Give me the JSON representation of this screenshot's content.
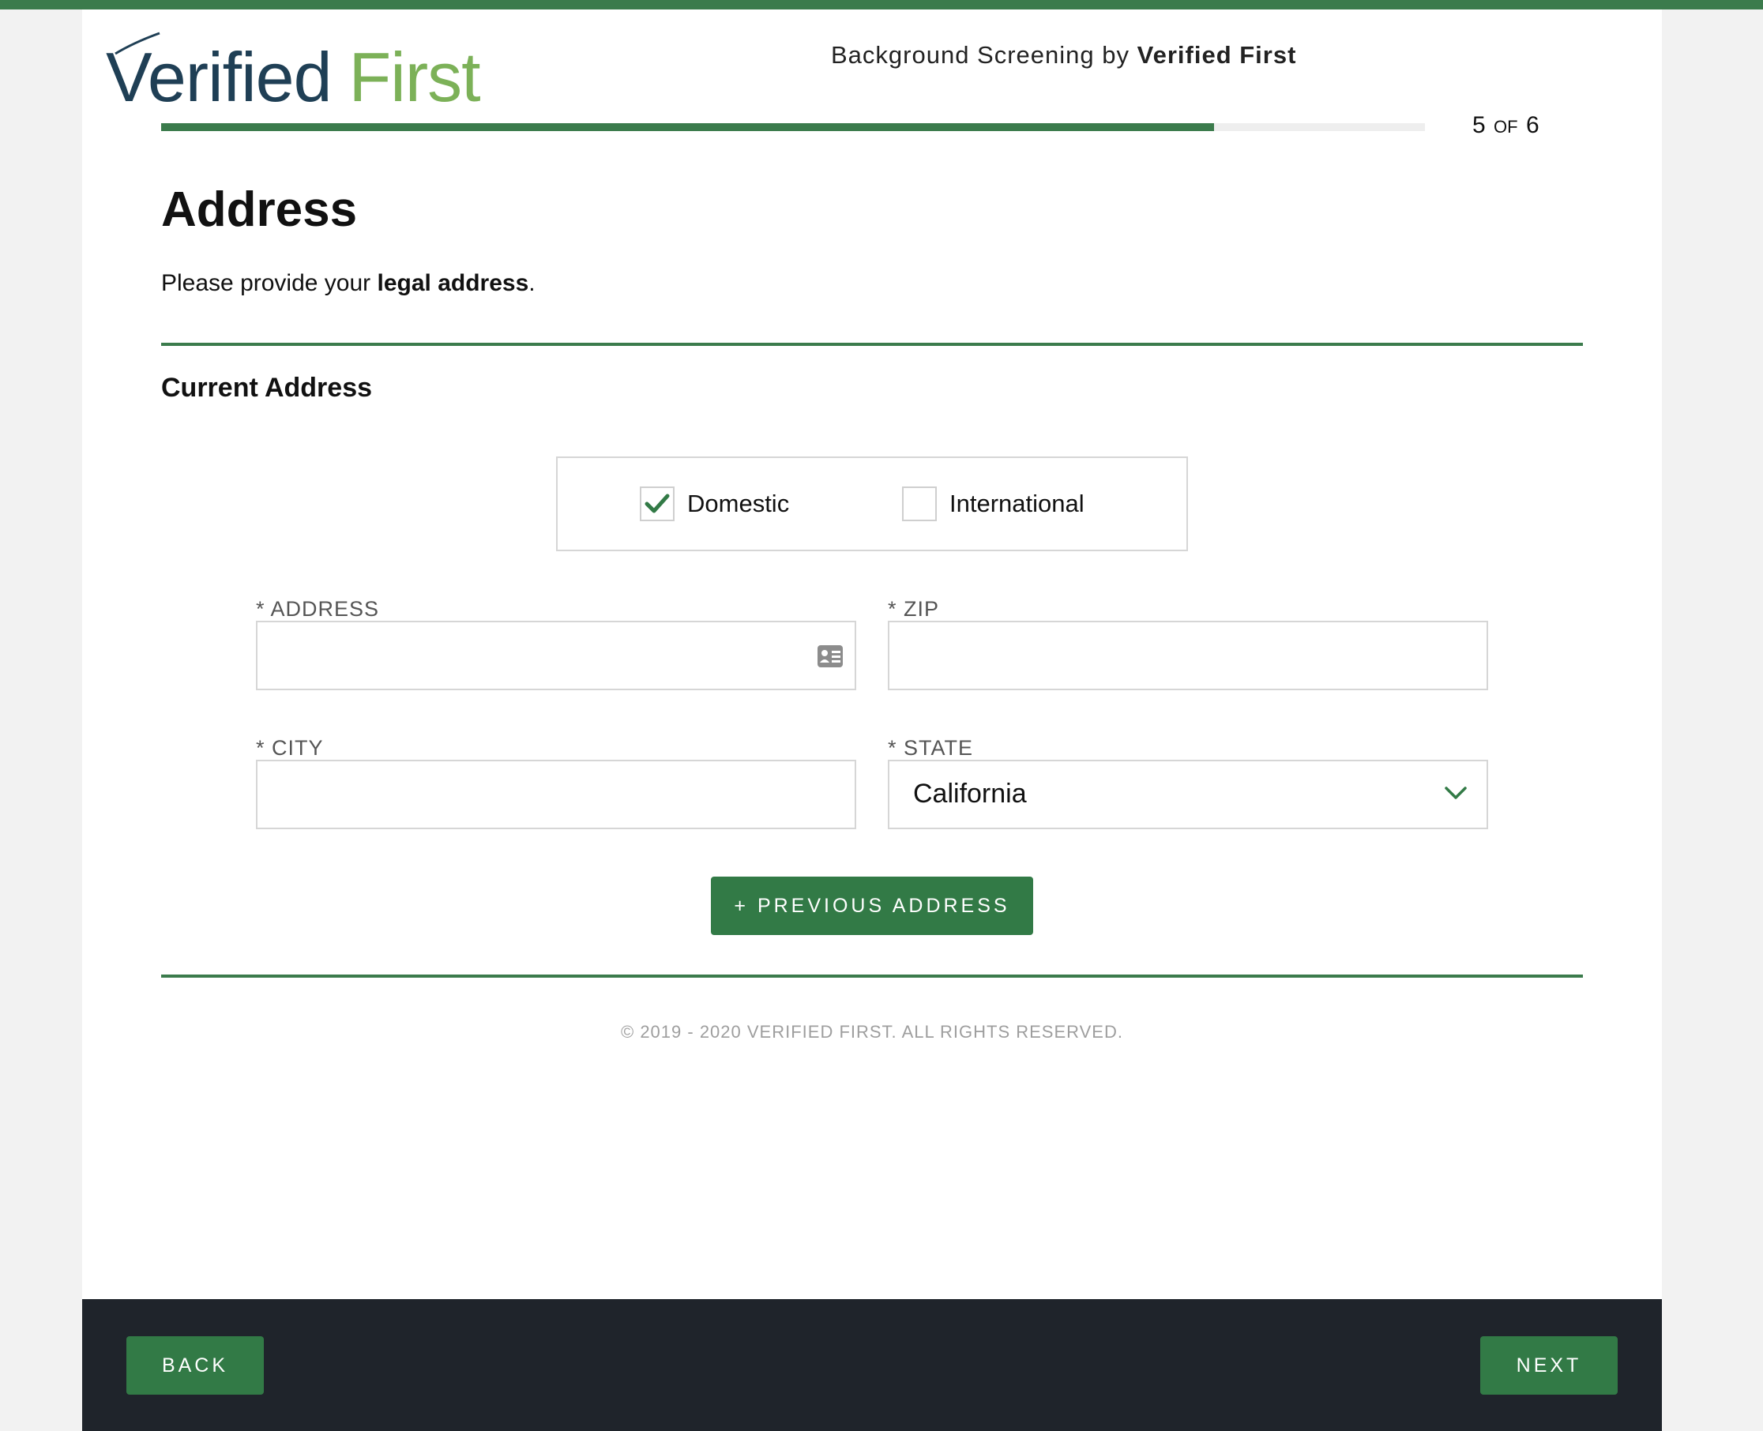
{
  "header": {
    "logo_part1": "Verified",
    "logo_part2": "First",
    "title_prefix": "Background Screening by",
    "title_brand": "Verified First"
  },
  "progress": {
    "current_step": "5",
    "of_label": "of",
    "total_steps": "6",
    "fraction_complete": 0.833
  },
  "main": {
    "title": "Address",
    "intro_prefix": "Please provide your",
    "intro_bold": "legal address",
    "intro_suffix": ".",
    "section_title": "Current Address"
  },
  "address_type": {
    "domestic_label": "Domestic",
    "international_label": "International",
    "selected": "Domestic"
  },
  "form": {
    "address_label": "* ADDRESS",
    "address_value": "",
    "zip_label": "* ZIP",
    "zip_value": "",
    "city_label": "* CITY",
    "city_value": "",
    "state_label": "* STATE",
    "state_value": "California",
    "previous_address_label": "+ PREVIOUS ADDRESS"
  },
  "footer": {
    "copyright": "© 2019 - 2020 VERIFIED FIRST. ALL RIGHTS RESERVED.",
    "back_label": "BACK",
    "next_label": "NEXT"
  },
  "colors": {
    "accent_green": "#3b7b4c",
    "button_green": "#327a46",
    "logo_navy": "#1f3f55",
    "logo_green": "#7cb158",
    "footer_dark": "#1f242b"
  },
  "icons": {
    "checkbox_checked": "checkmark-icon",
    "address_field": "contact-card-icon",
    "state_select": "chevron-down-icon"
  }
}
